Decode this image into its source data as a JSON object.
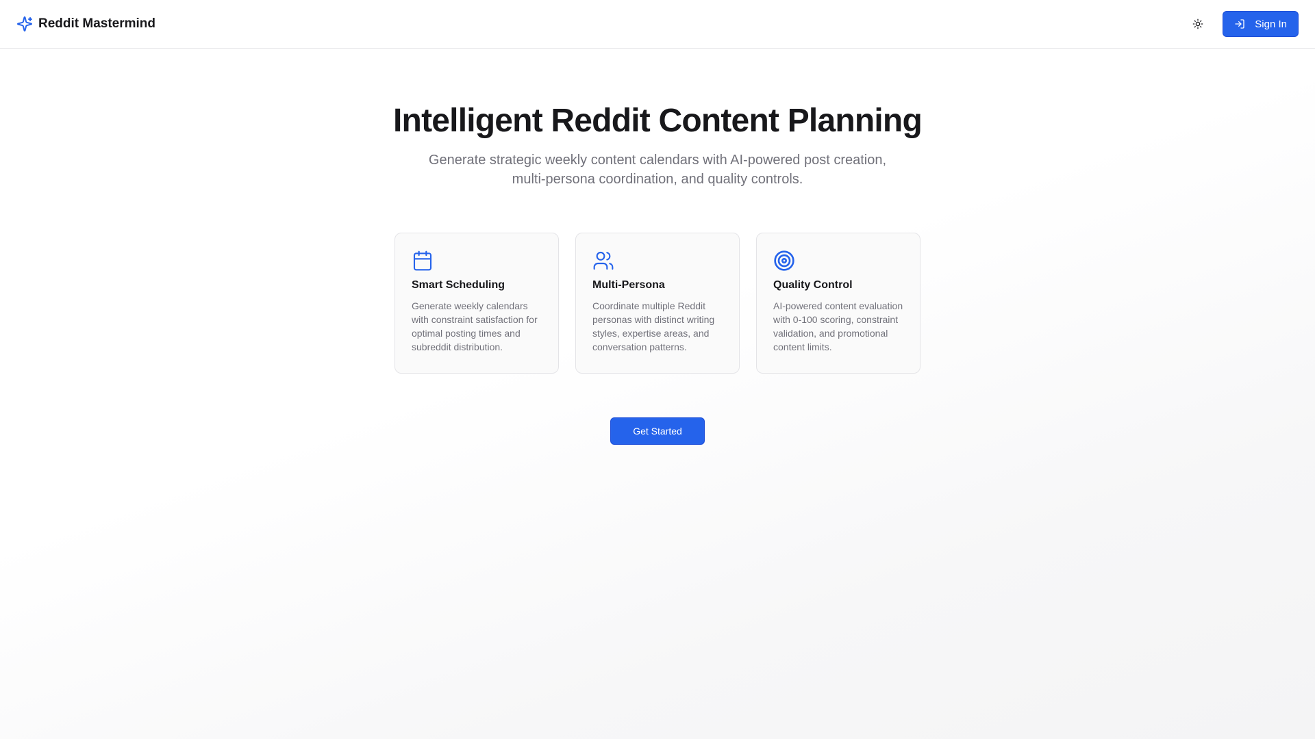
{
  "header": {
    "brand_name": "Reddit Mastermind",
    "brand_icon": "sparkles-icon",
    "theme_toggle_icon": "sun-icon",
    "sign_in_label": "Sign In",
    "sign_in_icon": "log-in-icon"
  },
  "hero": {
    "title": "Intelligent Reddit Content Planning",
    "subtitle": "Generate strategic weekly content calendars with AI-powered post creation, multi-persona coordination, and quality controls."
  },
  "features": [
    {
      "icon": "calendar-icon",
      "title": "Smart Scheduling",
      "description": "Generate weekly calendars with constraint satisfaction for optimal posting times and subreddit distribution."
    },
    {
      "icon": "users-icon",
      "title": "Multi-Persona",
      "description": "Coordinate multiple Reddit personas with distinct writing styles, expertise areas, and conversation patterns."
    },
    {
      "icon": "target-icon",
      "title": "Quality Control",
      "description": "AI-powered content evaluation with 0-100 scoring, constraint validation, and promotional content limits."
    }
  ],
  "cta": {
    "label": "Get Started"
  },
  "colors": {
    "accent": "#2563eb",
    "text_primary": "#18181b",
    "text_muted": "#71717a",
    "border": "#e4e4e7"
  }
}
